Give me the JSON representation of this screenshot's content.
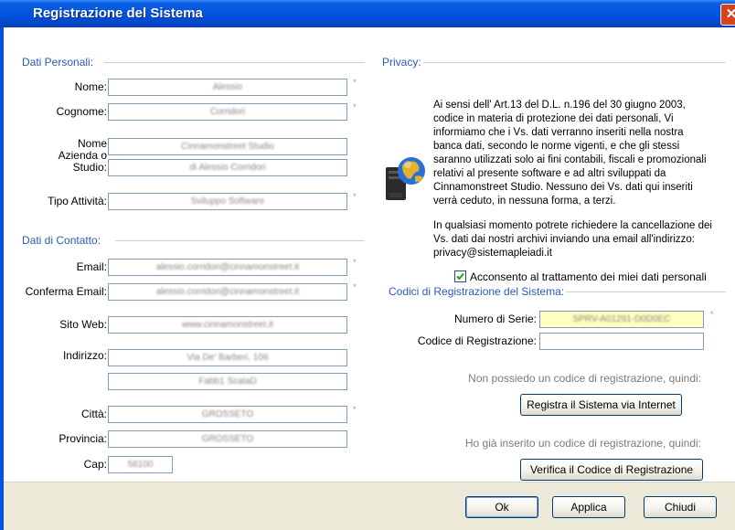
{
  "window": {
    "title": "Registrazione del Sistema",
    "close_glyph": "✕"
  },
  "dati_personali": {
    "header": "Dati Personali:",
    "nome": {
      "label": "Nome:",
      "value": "Alessio"
    },
    "cognome": {
      "label": "Cognome:",
      "value": "Corridori"
    },
    "azienda": {
      "label_line1": "Nome",
      "label_line2": "Azienda o",
      "label_line3": "Studio:",
      "value1": "Cinnamonstreet Studio",
      "value2": "di Alessio Corridori"
    },
    "tipo_attivita": {
      "label": "Tipo Attività:",
      "value": "Sviluppo Software"
    }
  },
  "dati_contatto": {
    "header": "Dati di Contatto:",
    "email": {
      "label": "Email:",
      "value": "alessio.corridori@cinnamonstreet.it"
    },
    "conferma_email": {
      "label": "Conferma Email:",
      "value": "alessio.corridori@cinnamonstreet.it"
    },
    "sito_web": {
      "label": "Sito Web:",
      "value": "www.cinnamonstreet.it"
    },
    "indirizzo": {
      "label": "Indirizzo:",
      "value1": "Via De' Barberi, 106",
      "value2": "Fabb1 ScalaD"
    },
    "citta": {
      "label": "Città:",
      "value": "GROSSETO"
    },
    "provincia": {
      "label": "Provincia:",
      "value": "GROSSETO"
    },
    "cap": {
      "label": "Cap:",
      "value": "58100"
    }
  },
  "required_marker": "*",
  "privacy": {
    "header": "Privacy:",
    "paragraph1": "Ai sensi dell' Art.13 del D.L. n.196 del 30 giugno 2003, codice in materia  di protezione dei dati personali, Vi informiamo che i Vs. dati verranno inseriti nella nostra banca dati, secondo le norme vigenti, e che gli stessi saranno utilizzati solo ai fini contabili, fiscali e promozionali relativi al presente software e ad altri sviluppati da Cinnamonstreet Studio. Nessuno dei Vs. dati qui inseriti verrà ceduto, in nessuna forma, a terzi.",
    "paragraph2": "In qualsiasi momento potrete richiedere la cancellazione dei Vs. dati dai nostri archivi inviando una email all'indirizzo: privacy@sistemapleiadi.it",
    "consent_label": "Acconsento al trattamento dei miei dati personali",
    "consent_checked": true,
    "icon": "computer-globe-icon"
  },
  "codici": {
    "header": "Codici di Registrazione del Sistema:",
    "numero_serie": {
      "label": "Numero di Serie:",
      "value": "SPRV-A01291-D0D0EC"
    },
    "codice_registrazione": {
      "label": "Codice di Registrazione:",
      "value": ""
    },
    "note_no_code": "Non possiedo un codice di registrazione, quindi:",
    "register_button": "Registra il Sistema via Internet",
    "note_has_code": "Ho già inserito un codice di registrazione, quindi:",
    "verify_button": "Verifica il Codice di Registrazione"
  },
  "footer": {
    "ok": "Ok",
    "applica": "Applica",
    "chiudi": "Chiudi"
  }
}
